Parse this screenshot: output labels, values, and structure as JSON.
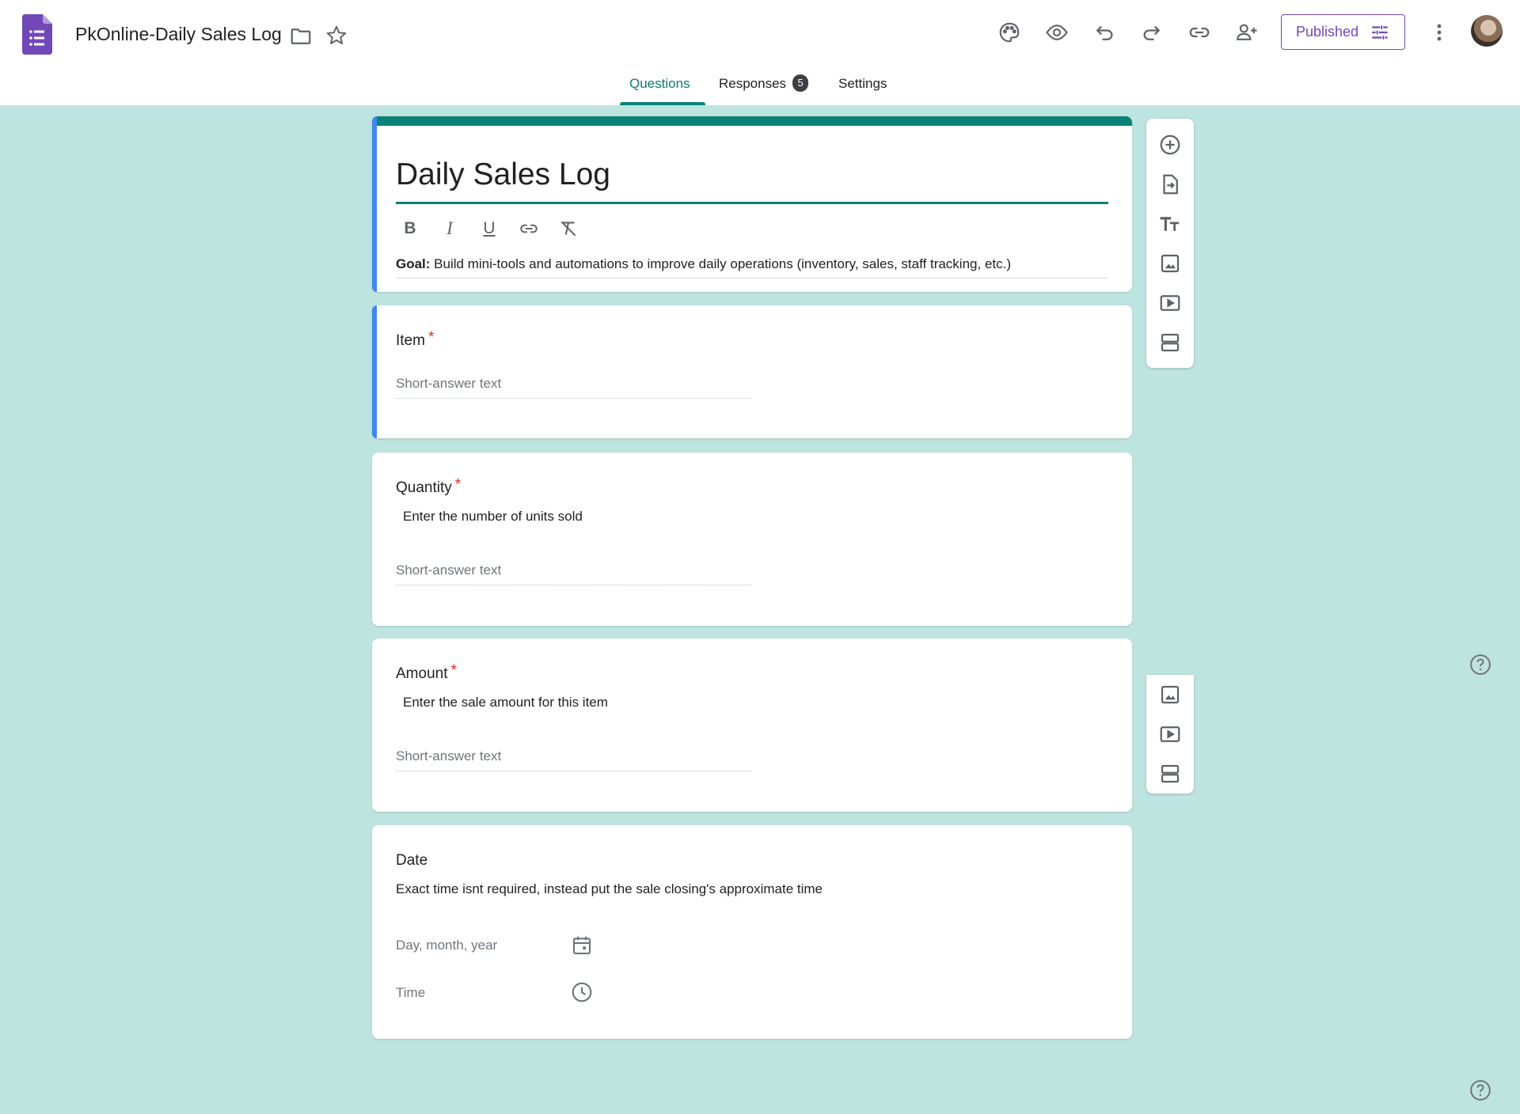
{
  "header": {
    "doc_title": "PkOnline-Daily Sales Log",
    "publish_label": "Published"
  },
  "tabs": [
    {
      "label": "Questions",
      "active": true
    },
    {
      "label": "Responses",
      "badge": "5"
    },
    {
      "label": "Settings"
    }
  ],
  "form": {
    "title": "Daily Sales Log",
    "description_bold": "Goal:",
    "description": " Build mini-tools and automations to improve daily operations (inventory, sales, staff tracking, etc.)",
    "formatting": [
      "B",
      "I",
      "U"
    ]
  },
  "questions": [
    {
      "title": "Item",
      "required": "*",
      "placeholder": "Short-answer text"
    },
    {
      "title": "Quantity",
      "required": "*",
      "description": "Enter the number of units sold",
      "placeholder": "Short-answer text"
    },
    {
      "title": "Amount",
      "required": "*",
      "description": "Enter the sale amount for this item",
      "placeholder": "Short-answer text"
    },
    {
      "title": "Date",
      "description": "Exact time isnt required, instead put the sale closing's approximate time",
      "date_placeholder": "Day, month, year",
      "time_placeholder": "Time"
    }
  ],
  "colors": {
    "accent": "#0b8276",
    "brand": "#7248b9",
    "background": "#bee4df",
    "active_question": "#4285f4",
    "required": "#d93025"
  }
}
